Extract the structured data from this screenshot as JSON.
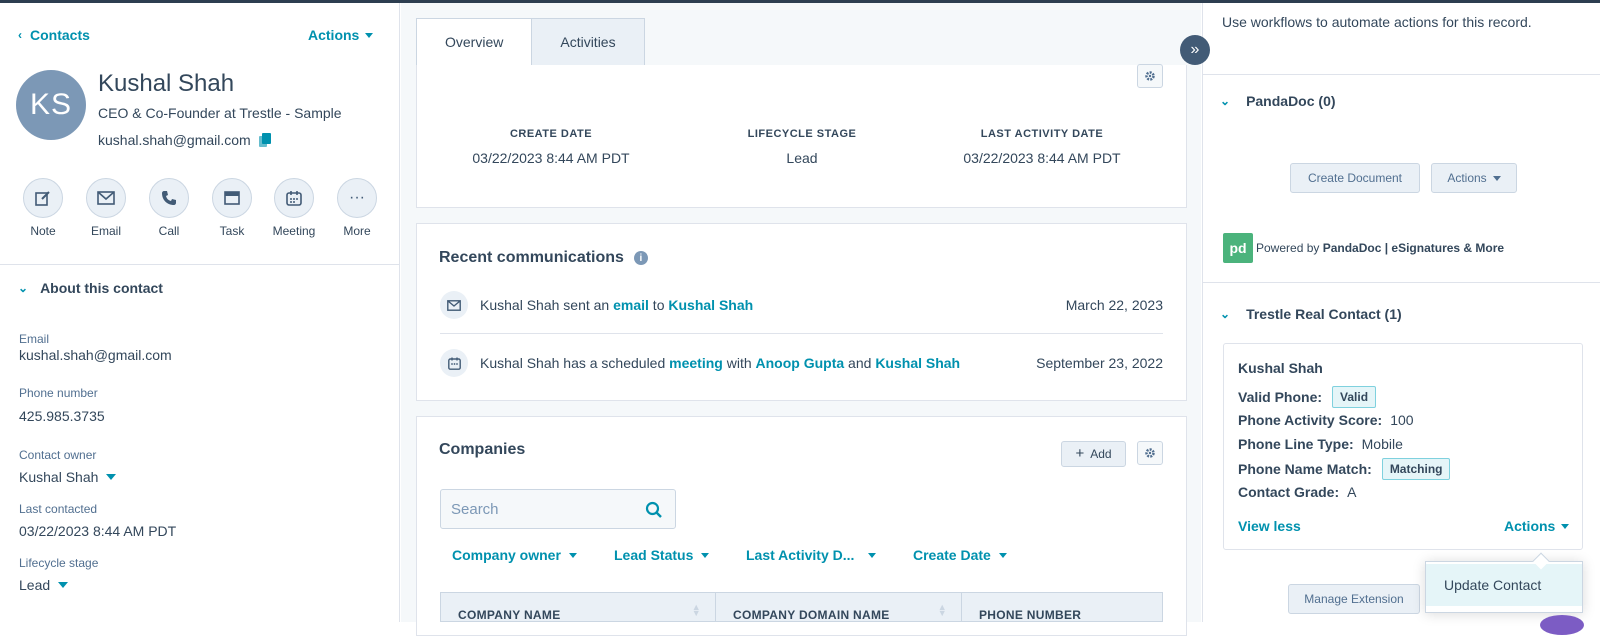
{
  "left": {
    "back_label": "Contacts",
    "actions_label": "Actions",
    "avatar_initials": "KS",
    "name": "Kushal Shah",
    "job_title": "CEO & Co-Founder at Trestle - Sample",
    "email": "kushal.shah@gmail.com",
    "quick_actions": [
      {
        "label": "Note",
        "icon": "note-icon"
      },
      {
        "label": "Email",
        "icon": "email-icon"
      },
      {
        "label": "Call",
        "icon": "phone-icon"
      },
      {
        "label": "Task",
        "icon": "task-icon"
      },
      {
        "label": "Meeting",
        "icon": "calendar-icon"
      },
      {
        "label": "More",
        "icon": "more-icon"
      }
    ],
    "about_title": "About this contact",
    "properties": [
      {
        "label": "Email",
        "value": "kushal.shah@gmail.com"
      },
      {
        "label": "Phone number",
        "value": "425.985.3735"
      },
      {
        "label": "Contact owner",
        "value": "Kushal Shah"
      },
      {
        "label": "Last contacted",
        "value": "03/22/2023 8:44 AM PDT"
      },
      {
        "label": "Lifecycle stage",
        "value": "Lead"
      }
    ]
  },
  "middle": {
    "tabs": [
      {
        "label": "Overview",
        "active": true
      },
      {
        "label": "Activities",
        "active": false
      }
    ],
    "stats": [
      {
        "key": "CREATE DATE",
        "value": "03/22/2023 8:44 AM PDT"
      },
      {
        "key": "LIFECYCLE STAGE",
        "value": "Lead"
      },
      {
        "key": "LAST ACTIVITY DATE",
        "value": "03/22/2023 8:44 AM PDT"
      }
    ],
    "recent_comm_title": "Recent communications",
    "communications": [
      {
        "icon": "email-icon",
        "t1": "Kushal Shah sent an ",
        "l1": "email",
        "t2": " to ",
        "l2": "Kushal Shah",
        "t3": "",
        "l3": "",
        "date": "March 22, 2023"
      },
      {
        "icon": "calendar-icon",
        "t1": "Kushal Shah has a scheduled ",
        "l1": "meeting",
        "t2": " with ",
        "l2": "Anoop Gupta",
        "t3": " and ",
        "l3": "Kushal Shah",
        "date": "September 23, 2022"
      }
    ],
    "companies_title": "Companies",
    "add_label": "Add",
    "search_placeholder": "Search",
    "filters": [
      "Company owner",
      "Lead Status",
      "Last Activity D...",
      "Create Date"
    ],
    "columns": [
      "COMPANY NAME",
      "COMPANY DOMAIN NAME",
      "PHONE NUMBER"
    ]
  },
  "right": {
    "workflow_text": "Use workflows to automate actions for this record.",
    "pandadoc_title": "PandaDoc (0)",
    "create_document": "Create Document",
    "actions_label": "Actions",
    "powered_prefix": "Powered by ",
    "powered_brand": "PandaDoc | eSignatures & More",
    "pandadoc_logo": "pd",
    "trestle_title": "Trestle Real Contact (1)",
    "trestle": {
      "name": "Kushal Shah",
      "valid_phone_label": "Valid Phone:",
      "valid_phone_value": "Valid",
      "activity_label": "Phone Activity Score:",
      "activity_value": "100",
      "line_type_label": "Phone Line Type:",
      "line_type_value": "Mobile",
      "name_match_label": "Phone Name Match:",
      "name_match_value": "Matching",
      "grade_label": "Contact Grade:",
      "grade_value": "A"
    },
    "view_less": "View less",
    "card_actions": "Actions",
    "menu_item": "Update Contact",
    "manage_extension": "Manage Extension"
  },
  "colors": {
    "accent": "#0091ae",
    "text": "#33475b",
    "avatar": "#7c98b6",
    "topbar": "#2d3e50"
  }
}
